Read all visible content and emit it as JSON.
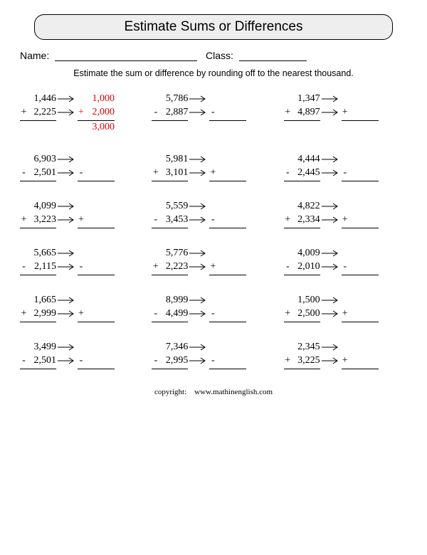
{
  "title": "Estimate Sums or Differences",
  "meta": {
    "name_label": "Name:",
    "class_label": "Class:"
  },
  "instruction": "Estimate the sum or difference by rounding off to the nearest thousand.",
  "example": {
    "round1": "1,000",
    "round2": "2,000",
    "answer": "3,000"
  },
  "problems": [
    {
      "a": "1,446",
      "b": "2,225",
      "op": "+",
      "example": true
    },
    {
      "a": "5,786",
      "b": "2,887",
      "op": "-"
    },
    {
      "a": "1,347",
      "b": "4,897",
      "op": "+"
    },
    {
      "a": "6,903",
      "b": "2,501",
      "op": "-"
    },
    {
      "a": "5,981",
      "b": "3,101",
      "op": "+"
    },
    {
      "a": "4,444",
      "b": "2,445",
      "op": "-"
    },
    {
      "a": "4,099",
      "b": "3,223",
      "op": "+"
    },
    {
      "a": "5,559",
      "b": "3,453",
      "op": "-"
    },
    {
      "a": "4,822",
      "b": "2,334",
      "op": "+"
    },
    {
      "a": "5,665",
      "b": "2,115",
      "op": "-"
    },
    {
      "a": "5,776",
      "b": "2,223",
      "op": "+"
    },
    {
      "a": "4,009",
      "b": "2,010",
      "op": "-"
    },
    {
      "a": "1,665",
      "b": "2,999",
      "op": "+"
    },
    {
      "a": "8,999",
      "b": "4,499",
      "op": "-"
    },
    {
      "a": "1,500",
      "b": "2,500",
      "op": "+"
    },
    {
      "a": "3,499",
      "b": "2,501",
      "op": "-"
    },
    {
      "a": "7,346",
      "b": "2,995",
      "op": "-"
    },
    {
      "a": "2,345",
      "b": "3,225",
      "op": "+"
    }
  ],
  "footer": {
    "copyright": "copyright:",
    "site": "www.mathinenglish.com"
  }
}
